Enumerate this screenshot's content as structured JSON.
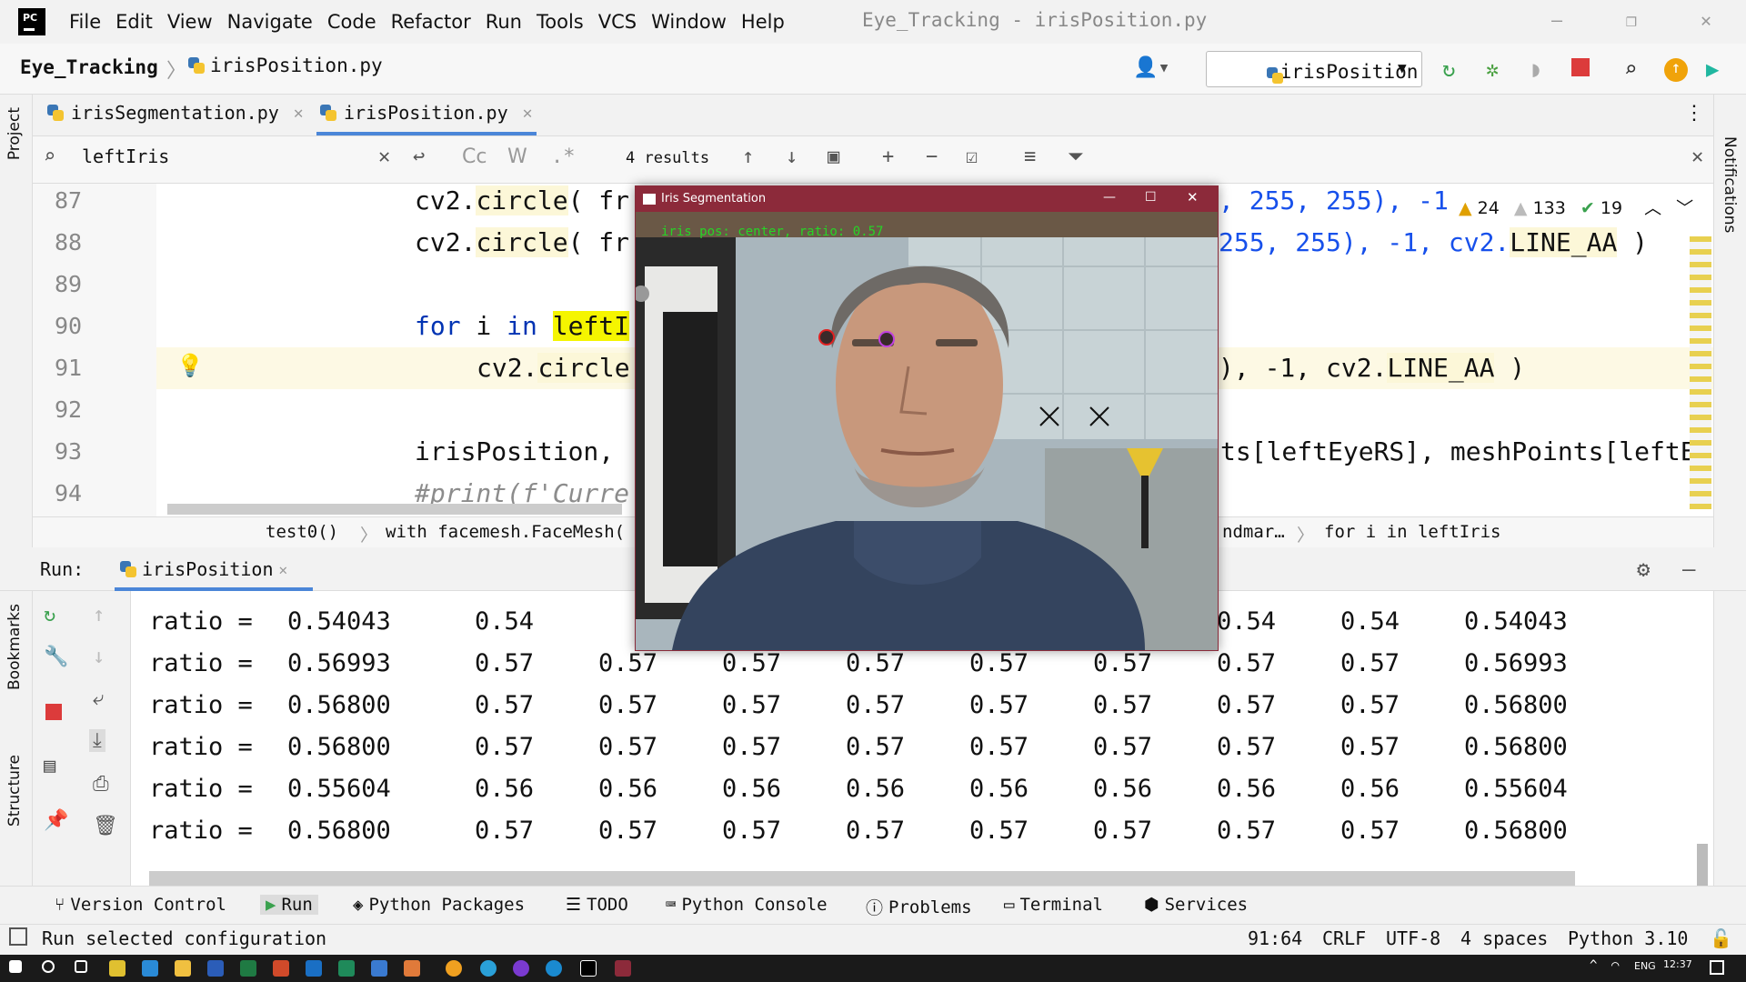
{
  "menu": [
    "File",
    "Edit",
    "View",
    "Navigate",
    "Code",
    "Refactor",
    "Run",
    "Tools",
    "VCS",
    "Window",
    "Help"
  ],
  "window_title": "Eye_Tracking - irisPosition.py",
  "nav": {
    "project": "Eye_Tracking",
    "file": "irisPosition.py",
    "run_config": "irisPosition"
  },
  "tabs": [
    {
      "label": "irisSegmentation.py"
    },
    {
      "label": "irisPosition.py"
    }
  ],
  "find": {
    "query": "leftIris",
    "results": "4 results",
    "opts": [
      "Cc",
      "W",
      ".*"
    ]
  },
  "inspections": {
    "warnings": "24",
    "weak": "133",
    "ok": "19"
  },
  "editor": {
    "lines": [
      "87",
      "88",
      "89",
      "90",
      "91",
      "92",
      "93",
      "94"
    ],
    "l87a": "cv2.",
    "l87b": "circle",
    "l87c": "( fr",
    "l87d": ", 255, 255), -1",
    "l88a": "cv2.",
    "l88b": "circle",
    "l88c": "( fr",
    "l88d": "255, 255), -1, cv2.",
    "l88e": "LINE_AA",
    " l88f": " )",
    "l90kw1": "for",
    "l90i": " i ",
    "l90kw2": "in",
    "l90var": "leftI",
    "l91a": "cv2.",
    "l91b": "circle",
    "l91c": "), -1, cv2.",
    "l91d": "LINE_AA",
    "l91e": " )",
    "l93a": "irisPosition,",
    "l93b": "ts[leftEyeRS], meshPoints[leftE",
    "l94": "#print(f'Curre"
  },
  "codecrumbs": [
    "test0()",
    "with facemesh.FaceMesh(",
    "ndmar…",
    "for i in leftIris"
  ],
  "run": {
    "label": "Run:",
    "tab": "irisPosition"
  },
  "output": [
    [
      "ratio =",
      "0.54043",
      "0.54",
      "0.5",
      "",
      "",
      "",
      "",
      "0.54",
      "0.54",
      "0.54043"
    ],
    [
      "ratio =",
      "0.56993",
      "0.57",
      "0.57",
      "0.57",
      "0.57",
      "0.57",
      "0.57",
      "0.57",
      "0.57",
      "0.56993"
    ],
    [
      "ratio =",
      "0.56800",
      "0.57",
      "0.57",
      "0.57",
      "0.57",
      "0.57",
      "0.57",
      "0.57",
      "0.57",
      "0.56800"
    ],
    [
      "ratio =",
      "0.56800",
      "0.57",
      "0.57",
      "0.57",
      "0.57",
      "0.57",
      "0.57",
      "0.57",
      "0.57",
      "0.56800"
    ],
    [
      "ratio =",
      "0.55604",
      "0.56",
      "0.56",
      "0.56",
      "0.56",
      "0.56",
      "0.56",
      "0.56",
      "0.56",
      "0.55604"
    ],
    [
      "ratio =",
      "0.56800",
      "0.57",
      "0.57",
      "0.57",
      "0.57",
      "0.57",
      "0.57",
      "0.57",
      "0.57",
      "0.56800"
    ]
  ],
  "bottom_tabs": [
    "Version Control",
    "Run",
    "Python Packages",
    "TODO",
    "Python Console",
    "Problems",
    "Terminal",
    "Services"
  ],
  "status": {
    "message": "Run selected configuration",
    "pos": "91:64",
    "eol": "CRLF",
    "enc": "UTF-8",
    "indent": "4 spaces",
    "interp": "Python 3.10"
  },
  "side": {
    "project": "Project",
    "bookmarks": "Bookmarks",
    "structure": "Structure",
    "notifications": "Notifications"
  },
  "cam": {
    "title": "Iris Segmentation",
    "overlay": "iris pos: center, ratio: 0.57"
  },
  "taskbar": {
    "lang": "ENG",
    "time": "12:37"
  },
  "colors": {
    "accent": "#4b86d8",
    "keyword": "#0033b3",
    "number": "#1750eb",
    "find_hl": "#f5f500",
    "cam_title": "#8c2a3a"
  }
}
